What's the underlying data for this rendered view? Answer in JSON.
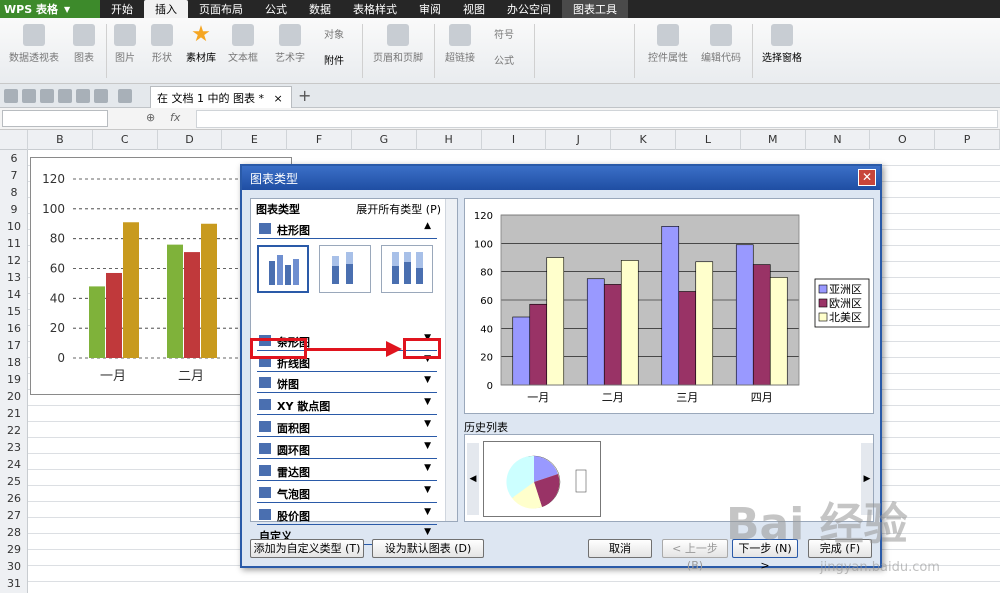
{
  "app": {
    "logo": "WPS 表格"
  },
  "menu": {
    "items": [
      "开始",
      "插入",
      "页面布局",
      "公式",
      "数据",
      "表格样式",
      "审阅",
      "视图",
      "办公空间"
    ],
    "active": "插入",
    "tool": "图表工具"
  },
  "ribbon": {
    "buttons": [
      {
        "label": "数据透视表",
        "on": false
      },
      {
        "label": "图表",
        "on": false
      },
      {
        "label": "图片",
        "on": false
      },
      {
        "label": "形状",
        "on": false
      },
      {
        "label": "素材库",
        "on": true
      },
      {
        "label": "文本框",
        "on": false
      },
      {
        "label": "艺术字",
        "on": false
      },
      {
        "label": "对象",
        "on": false
      },
      {
        "label": "附件",
        "on": true
      },
      {
        "label": "页眉和页脚",
        "on": false
      },
      {
        "label": "超链接",
        "on": false
      },
      {
        "label": "符号",
        "on": false
      },
      {
        "label": "公式",
        "on": false
      },
      {
        "label": "控件属性",
        "on": false
      },
      {
        "label": "编辑代码",
        "on": false
      },
      {
        "label": "选择窗格",
        "on": true
      }
    ]
  },
  "tabbar": {
    "doc_tab": "在 文档 1 中的 图表 *",
    "close": "×",
    "plus": "+"
  },
  "formula": {
    "fx": "fx",
    "zoom": "⊕"
  },
  "grid": {
    "columns": [
      "B",
      "C",
      "D",
      "E",
      "F",
      "G",
      "H",
      "I",
      "J",
      "K",
      "L",
      "M",
      "N",
      "O",
      "P"
    ],
    "rows": [
      "6",
      "7",
      "8",
      "9",
      "10",
      "11",
      "12",
      "13",
      "14",
      "15",
      "16",
      "17",
      "18",
      "19",
      "20",
      "21",
      "22",
      "23",
      "24",
      "25",
      "26",
      "27",
      "28",
      "29",
      "30",
      "31"
    ]
  },
  "embedded_chart": {
    "categories": [
      "一月",
      "二月"
    ],
    "series_values": [
      [
        48,
        57,
        91
      ],
      [
        76,
        71,
        90
      ]
    ],
    "ylim": [
      0,
      120
    ],
    "yticks": [
      "0",
      "20",
      "40",
      "60",
      "80",
      "100",
      "120"
    ],
    "colors": [
      "#7fb23a",
      "#c0393b",
      "#c89a1e"
    ]
  },
  "dialog": {
    "title": "图表类型",
    "close": "✕",
    "panel_header": "图表类型",
    "expand_all": "展开所有类型 (P)",
    "categories": [
      "柱形图",
      "条形图",
      "折线图",
      "饼图",
      "XY 散点图",
      "面积图",
      "圆环图",
      "雷达图",
      "气泡图",
      "股价图",
      "自定义"
    ],
    "history_label": "历史列表",
    "buttons": {
      "add_custom": "添加为自定义类型 (T)",
      "set_default": "设为默认图表 (D)",
      "cancel": "取消",
      "prev": "< 上一步 (B)",
      "next": "下一步 (N) >",
      "finish": "完成 (F)"
    }
  },
  "chart_data": {
    "type": "bar",
    "categories": [
      "一月",
      "二月",
      "三月",
      "四月"
    ],
    "series": [
      {
        "name": "亚洲区",
        "values": [
          48,
          75,
          112,
          99
        ],
        "color": "#9999ff"
      },
      {
        "name": "欧洲区",
        "values": [
          57,
          71,
          66,
          85
        ],
        "color": "#993366"
      },
      {
        "name": "北美区",
        "values": [
          90,
          88,
          87,
          76
        ],
        "color": "#ffffcc"
      }
    ],
    "ylim": [
      0,
      120
    ],
    "yticks": [
      "0",
      "20",
      "40",
      "60",
      "80",
      "100",
      "120"
    ],
    "legend": "right",
    "grid": true
  },
  "watermark": {
    "text": "Bai 经验",
    "sub": "jingyan.baidu.com"
  }
}
